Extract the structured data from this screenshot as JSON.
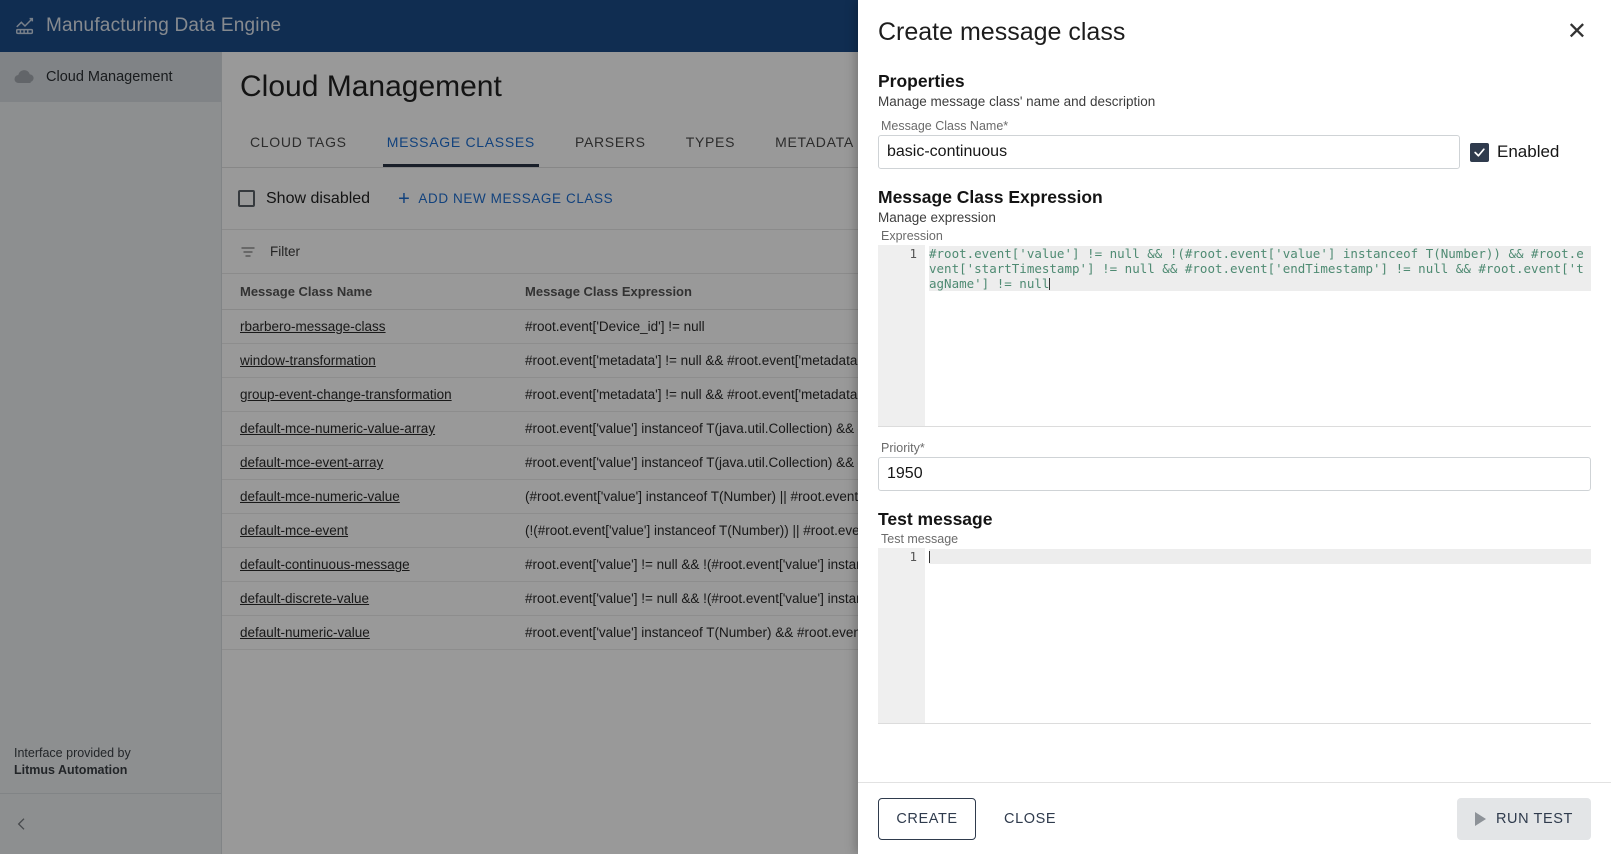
{
  "app": {
    "title": "Manufacturing Data Engine",
    "logo_icon": "chart-line-icon"
  },
  "sidebar": {
    "items": [
      {
        "label": "Cloud Management",
        "icon": "cloud-icon"
      }
    ],
    "footer": {
      "line1": "Interface provided by",
      "line2": "Litmus Automation"
    },
    "collapse_icon": "chevron-left-icon"
  },
  "page": {
    "title": "Cloud Management",
    "tabs": [
      {
        "label": "Cloud Tags",
        "active": false
      },
      {
        "label": "Message Classes",
        "active": true
      },
      {
        "label": "Parsers",
        "active": false
      },
      {
        "label": "Types",
        "active": false
      },
      {
        "label": "Metadata",
        "active": false
      }
    ],
    "toolbar": {
      "show_disabled_label": "Show disabled",
      "show_disabled_checked": false,
      "add_label": "Add new message class",
      "add_icon": "plus-icon"
    },
    "filter": {
      "label": "Filter",
      "icon": "filter-icon"
    },
    "table": {
      "columns": [
        "Message Class Name",
        "Message Class Expression"
      ],
      "rows": [
        {
          "name": "rbarbero-message-class",
          "expression": "#root.event['Device_id'] != null"
        },
        {
          "name": "window-transformation",
          "expression": "#root.event['metadata'] != null && #root.event['metadata'] != null"
        },
        {
          "name": "group-event-change-transformation",
          "expression": "#root.event['metadata'] != null && #root.event['metadata'] != null"
        },
        {
          "name": "default-mce-numeric-value-array",
          "expression": "#root.event['value'] instanceof T(java.util.Collection) && #root.event['value'] != null"
        },
        {
          "name": "default-mce-event-array",
          "expression": "#root.event['value'] instanceof T(java.util.Collection) && #root.event['value'] != null"
        },
        {
          "name": "default-mce-numeric-value",
          "expression": "(#root.event['value'] instanceof T(Number) || #root.event['value'] != null)"
        },
        {
          "name": "default-mce-event",
          "expression": "(!(#root.event['value'] instanceof T(Number)) || #root.event['value'] != null)"
        },
        {
          "name": "default-continuous-message",
          "expression": "#root.event['value'] != null && !(#root.event['value'] instanceof T(Number))"
        },
        {
          "name": "default-discrete-value",
          "expression": "#root.event['value'] != null && !(#root.event['value'] instanceof T(Number))"
        },
        {
          "name": "default-numeric-value",
          "expression": "#root.event['value'] instanceof T(Number) && #root.event['value'] != null"
        }
      ]
    }
  },
  "modal": {
    "title": "Create message class",
    "close_icon": "close-icon",
    "properties": {
      "heading": "Properties",
      "subtitle": "Manage message class' name and description",
      "name_label": "Message Class Name",
      "name_required": "*",
      "name_value": "basic-continuous",
      "enabled_label": "Enabled",
      "enabled_checked": true,
      "check_icon": "check-icon"
    },
    "expression_section": {
      "heading": "Message Class Expression",
      "subtitle": "Manage expression",
      "label": "Expression",
      "line_number": "1",
      "code": "#root.event['value'] != null && !(#root.event['value'] instanceof T(Number)) && #root.event['startTimestamp'] != null && #root.event['endTimestamp'] != null && #root.event['tagName'] != null"
    },
    "priority": {
      "label": "Priority",
      "required": "*",
      "value": "1950"
    },
    "test_section": {
      "heading": "Test message",
      "label": "Test message",
      "line_number": "1",
      "code": ""
    },
    "footer": {
      "create_label": "Create",
      "close_label": "Close",
      "run_test_label": "Run test",
      "run_test_icon": "play-icon"
    }
  },
  "colors": {
    "header_blue": "#1c4b87",
    "accent_blue": "#1f6fd0",
    "dark_navy": "#2f3b4d",
    "code_green": "#4e8a72",
    "scrim": "rgba(0,0,0,0.40)"
  }
}
